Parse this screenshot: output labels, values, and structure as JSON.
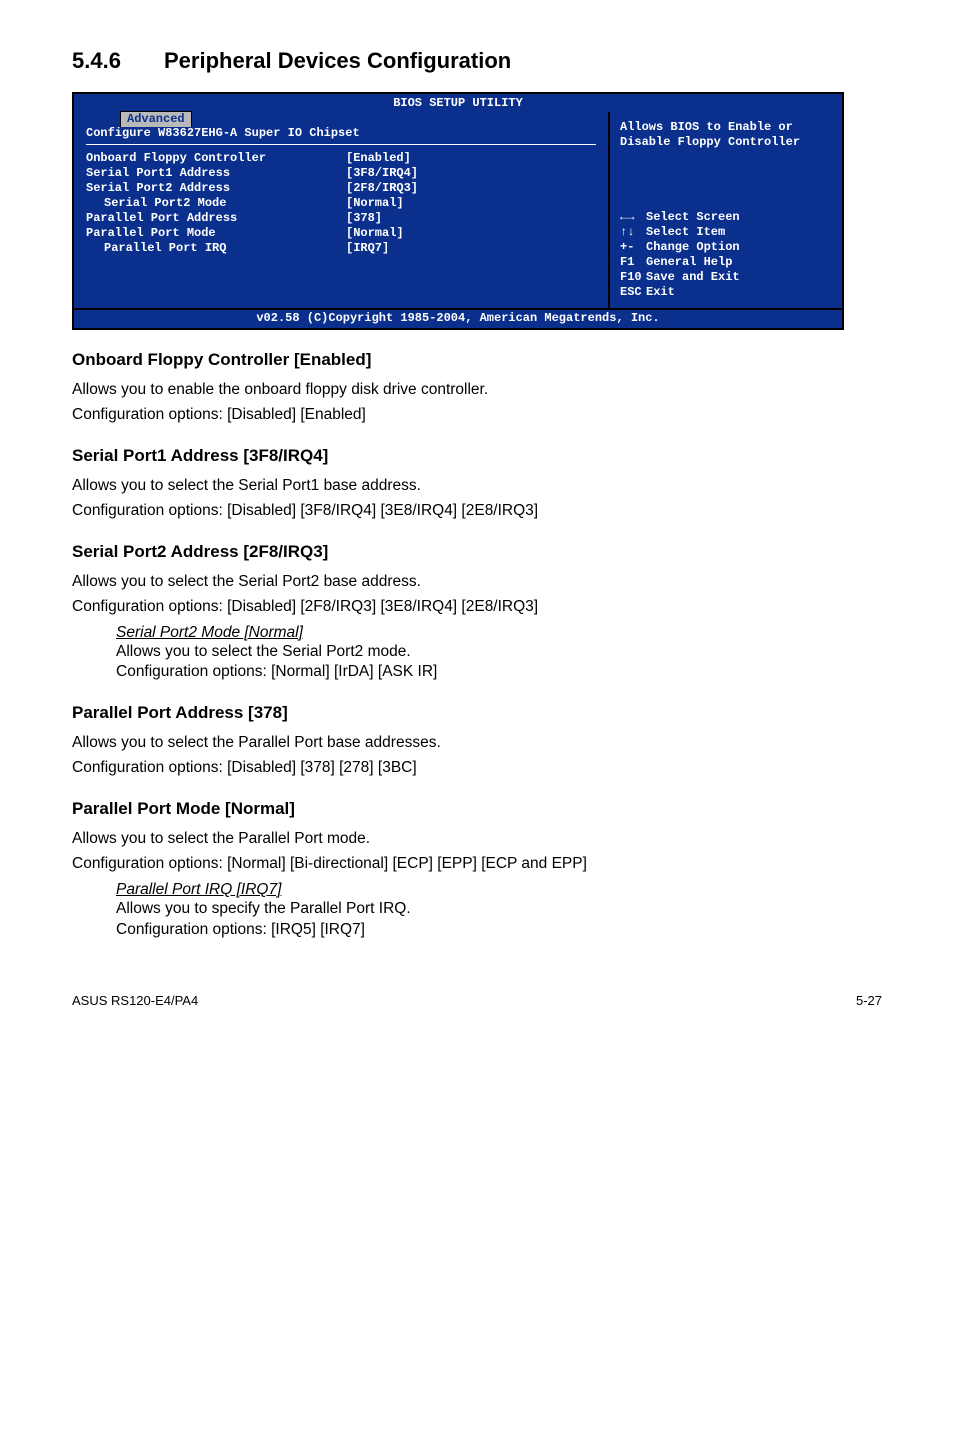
{
  "section": {
    "number": "5.4.6",
    "title": "Peripheral Devices Configuration"
  },
  "bios": {
    "titlebar": "BIOS SETUP UTILITY",
    "tab": "Advanced",
    "chipset_title": "Configure W83627EHG-A Super IO Chipset",
    "rows": [
      {
        "label": "Onboard Floppy Controller",
        "value": "[Enabled]",
        "indent": false
      },
      {
        "label": "Serial Port1 Address",
        "value": "[3F8/IRQ4]",
        "indent": false
      },
      {
        "label": "Serial Port2 Address",
        "value": "[2F8/IRQ3]",
        "indent": false
      },
      {
        "label": "Serial Port2 Mode",
        "value": "[Normal]",
        "indent": true
      },
      {
        "label": "Parallel Port Address",
        "value": "[378]",
        "indent": false
      },
      {
        "label": "Parallel Port Mode",
        "value": "[Normal]",
        "indent": false
      },
      {
        "label": "Parallel Port IRQ",
        "value": "[IRQ7]",
        "indent": true
      }
    ],
    "help": "Allows BIOS to Enable or Disable Floppy Controller",
    "keys": {
      "select_screen": "Select Screen",
      "select_item": "Select Item",
      "change_option": "Change Option",
      "general_help": "General Help",
      "save_exit": "Save and Exit",
      "exit": "Exit",
      "sym_lr": "←→",
      "sym_ud": "↑↓",
      "sym_pm": "+-",
      "sym_f1": "F1",
      "sym_f10": "F10",
      "sym_esc": "ESC"
    },
    "footer": "v02.58 (C)Copyright 1985-2004, American Megatrends, Inc."
  },
  "content": {
    "s1": {
      "h": "Onboard Floppy Controller [Enabled]",
      "p1": "Allows you to enable the onboard floppy disk drive controller.",
      "p2": "Configuration options: [Disabled] [Enabled]"
    },
    "s2": {
      "h": "Serial Port1 Address [3F8/IRQ4]",
      "p1": "Allows you to select the Serial Port1 base address.",
      "p2": "Configuration options: [Disabled] [3F8/IRQ4] [3E8/IRQ4] [2E8/IRQ3]"
    },
    "s3": {
      "h": "Serial Port2 Address [2F8/IRQ3]",
      "p1": "Allows you to select the Serial Port2 base address.",
      "p2": "Configuration options: [Disabled] [2F8/IRQ3] [3E8/IRQ4] [2E8/IRQ3]",
      "sub_t": "Serial Port2 Mode [Normal]",
      "sub_p1": "Allows you to select the Serial Port2 mode.",
      "sub_p2": "Configuration options: [Normal] [IrDA] [ASK IR]"
    },
    "s4": {
      "h": "Parallel Port Address [378]",
      "p1": "Allows you to select the Parallel Port base addresses.",
      "p2": "Configuration options: [Disabled] [378] [278] [3BC]"
    },
    "s5": {
      "h": "Parallel Port Mode [Normal]",
      "p1": "Allows you to select the Parallel Port mode.",
      "p2": "Configuration options: [Normal] [Bi-directional] [ECP] [EPP] [ECP and EPP]",
      "sub_t": "Parallel Port IRQ [IRQ7]",
      "sub_p1": "Allows you to specify the Parallel Port IRQ.",
      "sub_p2": "Configuration options: [IRQ5] [IRQ7]"
    }
  },
  "footer": {
    "left": "ASUS RS120-E4/PA4",
    "right": "5-27"
  }
}
